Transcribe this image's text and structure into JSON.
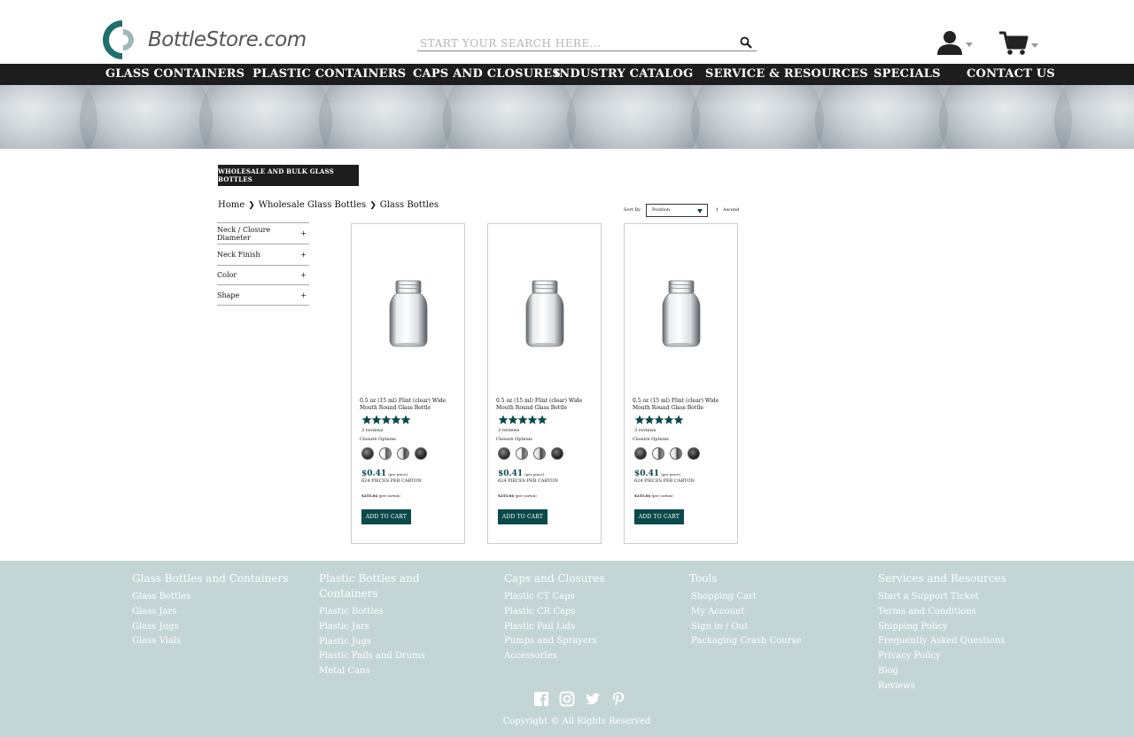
{
  "brand": {
    "name": "BottleStore.com",
    "accent": "#0b4a4a",
    "logo_teal": "#1f6f6a"
  },
  "search": {
    "placeholder": "START YOUR SEARCH HERE..."
  },
  "nav": [
    "GLASS CONTAINERS",
    "PLASTIC CONTAINERS",
    "CAPS AND CLOSURES",
    "INDUSTRY CATALOG",
    "SERVICE & RESOURCES",
    "SPECIALS",
    "CONTACT US"
  ],
  "page_title": "WHOLESALE AND BULK GLASS BOTTLES",
  "breadcrumb": [
    "Home",
    "Wholesale Glass Bottles",
    "Glass Bottles"
  ],
  "sort": {
    "label": "Sort By",
    "value": "Position",
    "direction": "Ascend"
  },
  "filters": [
    "Neck / Closure Diameter",
    "Neck Finish",
    "Color",
    "Shape"
  ],
  "filter_toggle": "+",
  "products": [
    {
      "name": "0.5 oz (15 ml) Flint (clear) Wide Mouth Round Glass Bottle",
      "rating": 5,
      "reviews": "3 reviews",
      "closure_label": "Closure Options",
      "price": "$0.41",
      "price_unit": "(per piece)",
      "pieces": "624 PIECES PER CARTON",
      "carton_price": "$255.84",
      "carton_unit": "(per carton)",
      "button": "ADD TO CART"
    },
    {
      "name": "0.5 oz (15 ml) Flint (clear) Wide Mouth Round Glass Bottle",
      "rating": 5,
      "reviews": "3 reviews",
      "closure_label": "Closure Options",
      "price": "$0.41",
      "price_unit": "(per piece)",
      "pieces": "624 PIECES PER CARTON",
      "carton_price": "$255.84",
      "carton_unit": "(per carton)",
      "button": "ADD TO CART"
    },
    {
      "name": "0.5 oz (15 ml) Flint (clear) Wide Mouth Round Glass Bottle",
      "rating": 5,
      "reviews": "3 reviews",
      "closure_label": "Closure Options",
      "price": "$0.41",
      "price_unit": "(per piece)",
      "pieces": "624 PIECES PER CARTON",
      "carton_price": "$255.84",
      "carton_unit": "(per carton)",
      "button": "ADD TO CART"
    }
  ],
  "footer": {
    "columns": [
      {
        "title": "Glass Bottles and Containers",
        "links": [
          "Glass Bottles",
          "Glass Jars",
          "Glass Jugs",
          "Glass Vials"
        ]
      },
      {
        "title": "Plastic Bottles and Containers",
        "links": [
          "Plastic Bottles",
          "Plastic Jars",
          "Plastic Jugs",
          "Plastic Pails and Drums",
          "Metal Cans"
        ]
      },
      {
        "title": "Caps and Closures",
        "links": [
          "Plastic CT Caps",
          "Plastic CR Caps",
          "Plastic Pail Lids",
          "Pumps and Sprayers",
          "Accessories"
        ]
      },
      {
        "title": "Tools",
        "links": [
          "Shopping Cart",
          "My Account",
          "Sign in / Out",
          "Packaging Crash Course"
        ]
      },
      {
        "title": "Services and Resources",
        "links": [
          "Start a Support Ticket",
          "Terms and Conditions",
          "Shipping Policy",
          "Frequently Asked Questions",
          "Privacy Policy",
          "Blog",
          "Reviews"
        ]
      }
    ],
    "social": [
      "facebook-icon",
      "instagram-icon",
      "twitter-icon",
      "pinterest-icon"
    ],
    "copyright": "Copyright © All Rights Reserved"
  }
}
